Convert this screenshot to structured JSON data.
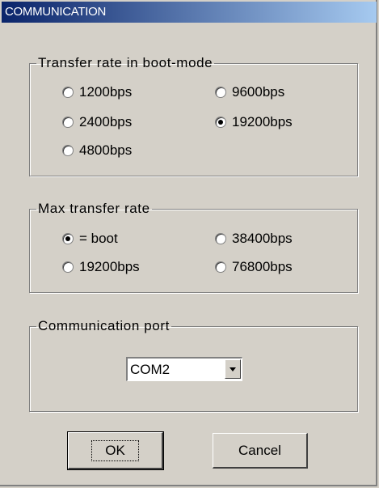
{
  "window": {
    "title": "COMMUNICATION"
  },
  "boot_rate": {
    "legend": "Transfer rate in boot-mode",
    "options": [
      {
        "label": "1200bps",
        "checked": false
      },
      {
        "label": "9600bps",
        "checked": false
      },
      {
        "label": "2400bps",
        "checked": false
      },
      {
        "label": "19200bps",
        "checked": true
      },
      {
        "label": "4800bps",
        "checked": false
      }
    ]
  },
  "max_rate": {
    "legend": "Max transfer rate",
    "options": [
      {
        "label": "= boot",
        "checked": true
      },
      {
        "label": "38400bps",
        "checked": false
      },
      {
        "label": "19200bps",
        "checked": false
      },
      {
        "label": "76800bps",
        "checked": false
      }
    ]
  },
  "port": {
    "legend": "Communication port",
    "selected": "COM2"
  },
  "buttons": {
    "ok": "OK",
    "cancel": "Cancel"
  }
}
